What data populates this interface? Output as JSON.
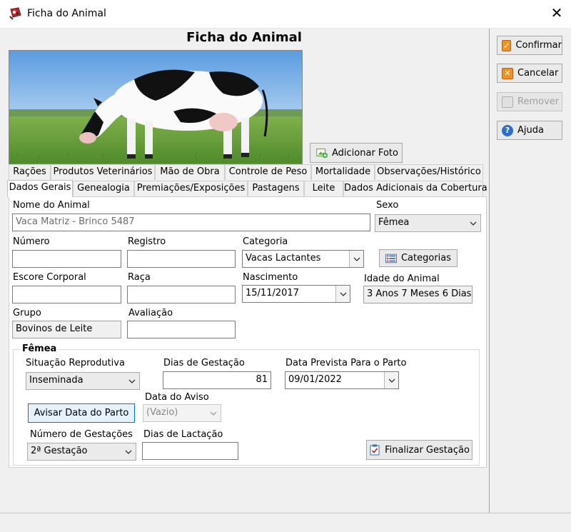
{
  "window": {
    "title": "Ficha do Animal",
    "close_icon": "close-icon"
  },
  "form": {
    "title": "Ficha do Animal",
    "add_photo_label": "Adicionar Foto"
  },
  "side_buttons": {
    "confirm": "Confirmar",
    "cancel": "Cancelar",
    "remove": "Remover",
    "help": "Ajuda"
  },
  "tabs_row1": [
    "Rações",
    "Produtos Veterinários",
    "Mão de Obra",
    "Controle de Peso",
    "Mortalidade",
    "Observações/Histórico"
  ],
  "tabs_row2": [
    "Dados Gerais",
    "Genealogia",
    "Premiações/Exposições",
    "Pastagens",
    "Leite",
    "Dados Adicionais da Cobertura"
  ],
  "active_tab": "Dados Gerais",
  "fields": {
    "nome_label": "Nome do Animal",
    "nome_value": "Vaca Matriz - Brinco 5487",
    "sexo_label": "Sexo",
    "sexo_value": "Fêmea",
    "numero_label": "Número",
    "numero_value": "",
    "registro_label": "Registro",
    "registro_value": "",
    "categoria_label": "Categoria",
    "categoria_value": "Vacas Lactantes",
    "categorias_button": "Categorias",
    "escore_label": "Escore Corporal",
    "escore_value": "",
    "raca_label": "Raça",
    "raca_value": "",
    "nascimento_label": "Nascimento",
    "nascimento_value": "15/11/2017",
    "idade_label": "Idade do Animal",
    "idade_value": "3 Anos 7 Meses 6 Dias",
    "grupo_label": "Grupo",
    "grupo_value": "Bovinos de Leite",
    "avaliacao_label": "Avaliação",
    "avaliacao_value": ""
  },
  "femea": {
    "title": "Fêmea",
    "situacao_label": "Situação Reprodutiva",
    "situacao_value": "Inseminada",
    "dias_gestacao_label": "Dias de Gestação",
    "dias_gestacao_value": "81",
    "data_prevista_label": "Data Prevista Para o Parto",
    "data_prevista_value": "09/01/2022",
    "avisar_button": "Avisar Data do Parto",
    "data_aviso_label": "Data do Aviso",
    "data_aviso_value": "(Vazio)",
    "num_gestacoes_label": "Número de Gestações",
    "num_gestacoes_value": "2ª Gestação",
    "dias_lactacao_label": "Dias de Lactação",
    "dias_lactacao_value": "",
    "finalizar_button": "Finalizar Gestação"
  },
  "colors": {
    "accent_orange": "#f09020",
    "focus_blue": "#0078d7",
    "help_blue": "#2c6fc9"
  }
}
